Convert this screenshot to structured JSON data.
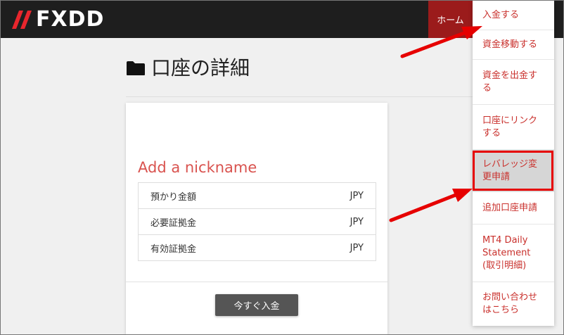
{
  "header": {
    "logo_text": "FXDD",
    "home_tab": "ホーム"
  },
  "page": {
    "title": "口座の詳細"
  },
  "card": {
    "nickname_link": "Add a nickname",
    "rows": [
      {
        "label": "預かり金額",
        "value": "JPY"
      },
      {
        "label": "必要証拠金",
        "value": "JPY"
      },
      {
        "label": "有効証拠金",
        "value": "JPY"
      }
    ],
    "deposit_button": "今すぐ入金"
  },
  "menu": {
    "items": [
      {
        "label": "入金する"
      },
      {
        "label": "資金移動する"
      },
      {
        "label": "資金を出金する"
      },
      {
        "label": "口座にリンクする"
      },
      {
        "label": "レバレッジ変更申請"
      },
      {
        "label": "追加口座申請"
      },
      {
        "label": "MT4 Daily Statement (取引明細)"
      },
      {
        "label": "お問い合わせはこちら"
      }
    ],
    "highlighted_index": 4
  },
  "colors": {
    "accent_red": "#c9302c",
    "home_tab_bg": "#9b1b1b",
    "annotation_red": "#e60000"
  }
}
